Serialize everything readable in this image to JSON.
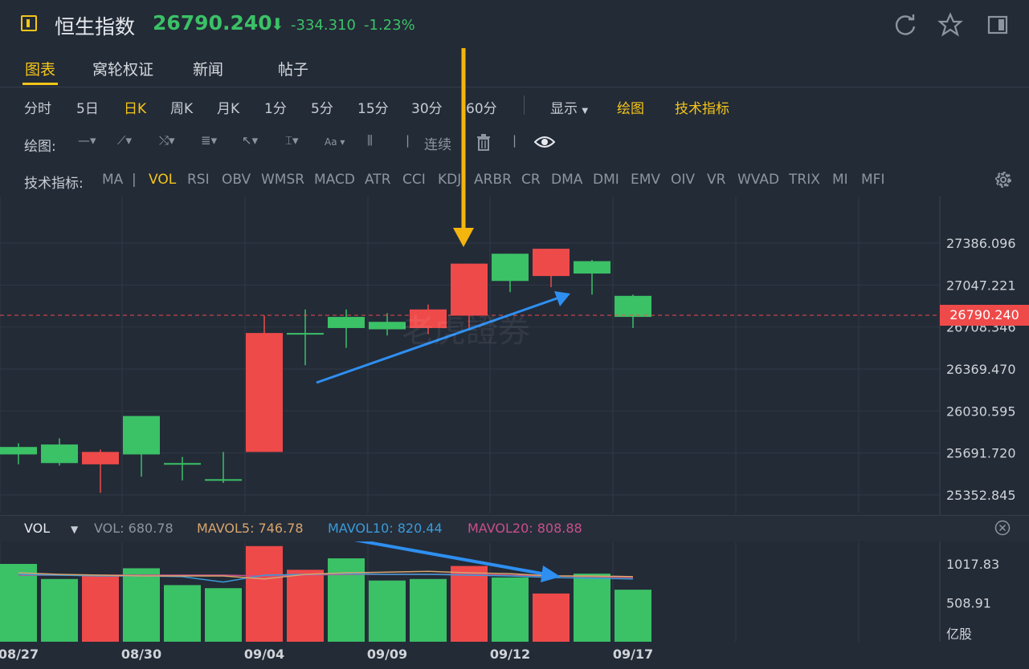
{
  "header": {
    "title": "恒生指数",
    "price": "26790.240",
    "arrow": "⬇",
    "change": "-334.310",
    "change_pct": "-1.23%",
    "colors": {
      "up": "#ef4a4a",
      "down": "#3bc166",
      "accent": "#f5c518"
    }
  },
  "tabs": [
    {
      "label": "图表",
      "active": true
    },
    {
      "label": "窝轮权证"
    },
    {
      "label": "新闻"
    },
    {
      "label": "帖子"
    }
  ],
  "periods": [
    "分时",
    "5日",
    "日K",
    "周K",
    "月K",
    "1分",
    "5分",
    "15分",
    "30分",
    "60分"
  ],
  "period_active": "日K",
  "toolbar_right": {
    "display": "显示",
    "draw": "绘图",
    "indicators": "技术指标"
  },
  "draw_toolbar": {
    "label": "绘图:",
    "continuous": "连续",
    "icons": [
      "line-tool-icon",
      "ray-tool-icon",
      "path-tool-icon",
      "fibonacci-icon",
      "arrow-tool-icon",
      "measure-tool-icon",
      "text-tool-icon",
      "candle-tool-icon",
      "trash-icon",
      "eye-icon"
    ]
  },
  "indicator_bar": {
    "label": "技术指标:",
    "items": [
      "MA",
      "VOL",
      "RSI",
      "OBV",
      "WMSR",
      "MACD",
      "ATR",
      "CCI",
      "KDJ",
      "ARBR",
      "CR",
      "DMA",
      "DMI",
      "EMV",
      "OIV",
      "VR",
      "WVAD",
      "TRIX",
      "MI",
      "MFI"
    ],
    "active": "VOL"
  },
  "watermark": "老虎證券",
  "current_price_tag": "26790.240",
  "vol_header": {
    "selector": "VOL",
    "vol": "VOL: 680.78",
    "mavol5": "MAVOL5: 746.78",
    "mavol10": "MAVOL10: 820.44",
    "mavol20": "MAVOL20: 808.88"
  },
  "chart_data": [
    {
      "type": "candlestick",
      "y_ticks": [
        "27386.096",
        "27047.221",
        "26708.346",
        "26369.470",
        "26030.595",
        "25691.720",
        "25352.845"
      ],
      "ylim": [
        25352.845,
        27386.096
      ],
      "current_price": 26790.24,
      "x_tick_labels": [
        "08/27",
        "08/30",
        "09/04",
        "09/09",
        "09/12",
        "09/17"
      ],
      "candles": [
        {
          "open": 25740,
          "close": 25680,
          "high": 25770,
          "low": 25600
        },
        {
          "open": 25760,
          "close": 25610,
          "high": 25810,
          "low": 25590
        },
        {
          "open": 25600,
          "close": 25700,
          "high": 25720,
          "low": 25370
        },
        {
          "open": 25990,
          "close": 25680,
          "high": 25990,
          "low": 25500
        },
        {
          "open": 25610,
          "close": 25605,
          "high": 25660,
          "low": 25470
        },
        {
          "open": 25480,
          "close": 25475,
          "high": 25700,
          "low": 25450
        },
        {
          "open": 25700,
          "close": 26660,
          "high": 26800,
          "low": 25700
        },
        {
          "open": 26660,
          "close": 26655,
          "high": 26850,
          "low": 26400
        },
        {
          "open": 26790,
          "close": 26700,
          "high": 26850,
          "low": 26540
        },
        {
          "open": 26750,
          "close": 26690,
          "high": 26820,
          "low": 26640
        },
        {
          "open": 26700,
          "close": 26850,
          "high": 26890,
          "low": 26650
        },
        {
          "open": 26800,
          "close": 27220,
          "high": 27220,
          "low": 26700
        },
        {
          "open": 27300,
          "close": 27080,
          "high": 27300,
          "low": 26990
        },
        {
          "open": 27120,
          "close": 27340,
          "high": 27340,
          "low": 27030
        },
        {
          "open": 27240,
          "close": 27140,
          "high": 27250,
          "low": 26970
        },
        {
          "open": 26960,
          "close": 26790,
          "high": 26970,
          "low": 26700
        }
      ]
    },
    {
      "type": "bar",
      "unit": "亿股",
      "y_ticks": [
        "1017.83",
        "508.91"
      ],
      "values": [
        1017,
        820,
        860,
        960,
        740,
        700,
        1250,
        940,
        1090,
        800,
        820,
        990,
        840,
        630,
        890,
        680
      ],
      "colors": [
        "down",
        "down",
        "up",
        "down",
        "down",
        "down",
        "up",
        "up",
        "down",
        "down",
        "down",
        "up",
        "down",
        "up",
        "down",
        "down"
      ],
      "mavol5": [
        900,
        880,
        870,
        860,
        860,
        860,
        820,
        880,
        900,
        910,
        920,
        900,
        890,
        860,
        860,
        850
      ],
      "mavol10": [
        880,
        870,
        860,
        860,
        850,
        780,
        870,
        880,
        890,
        880,
        880,
        870,
        860,
        840,
        830,
        820
      ],
      "mavol20": [
        870,
        870,
        870,
        870,
        870,
        870,
        860,
        870,
        880,
        880,
        880,
        880,
        870,
        860,
        850,
        840
      ]
    }
  ]
}
